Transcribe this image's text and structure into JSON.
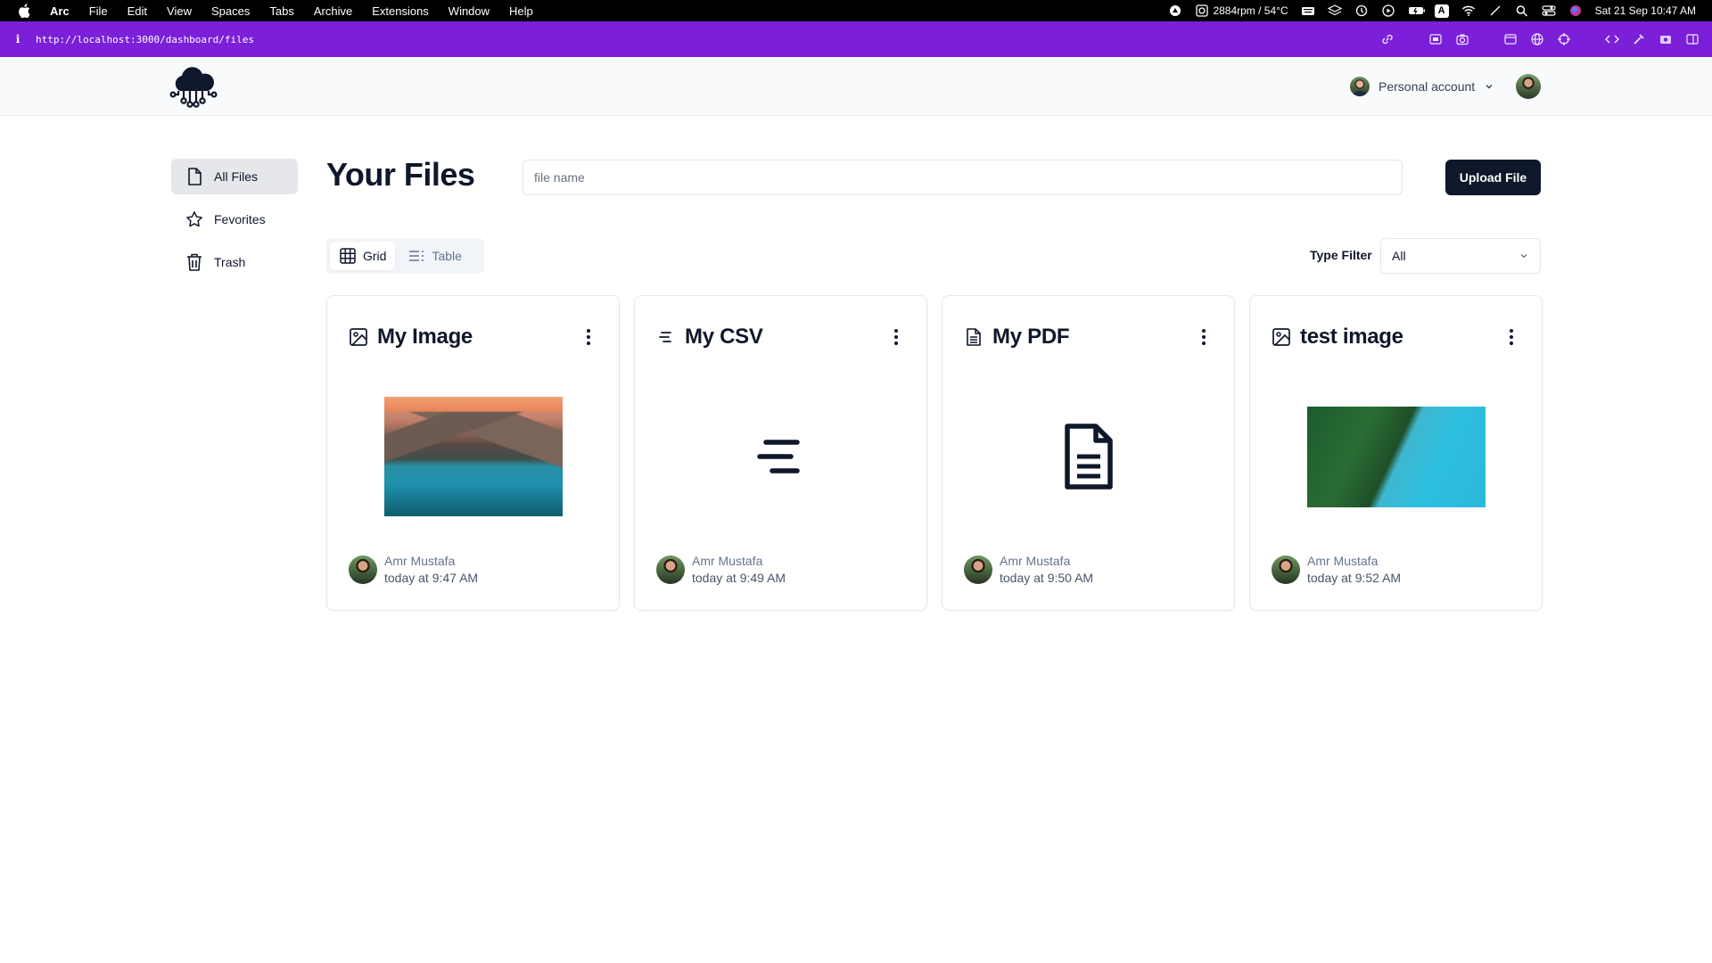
{
  "menubar": {
    "app_name": "Arc",
    "menus": [
      "File",
      "Edit",
      "View",
      "Spaces",
      "Tabs",
      "Archive",
      "Extensions",
      "Window",
      "Help"
    ],
    "fan_stats": "2884rpm / 54°C",
    "input_source": "A",
    "clock": "Sat 21 Sep  10:47 AM"
  },
  "browser": {
    "url": "http://localhost:3000/dashboard/files",
    "info_icon": "i",
    "accent_color": "#7b1fd8"
  },
  "header": {
    "org_label": "Personal account"
  },
  "sidebar": {
    "items": [
      {
        "label": "All Files",
        "icon": "file-icon",
        "active": true
      },
      {
        "label": "Fevorites",
        "icon": "star-icon",
        "active": false
      },
      {
        "label": "Trash",
        "icon": "trash-icon",
        "active": false
      }
    ]
  },
  "main": {
    "title": "Your Files",
    "search_placeholder": "file name",
    "upload_label": "Upload File",
    "view_toggle": {
      "grid": "Grid",
      "table": "Table",
      "selected": "Grid"
    },
    "type_filter": {
      "label": "Type Filter",
      "value": "All"
    }
  },
  "files": [
    {
      "name": "My Image",
      "type": "image",
      "preview": "mountain-lake-photo",
      "author": "Amr Mustafa",
      "date": "today at 9:47 AM"
    },
    {
      "name": "My CSV",
      "type": "csv",
      "preview": "csv-lines-icon",
      "author": "Amr Mustafa",
      "date": "today at 9:49 AM"
    },
    {
      "name": "My PDF",
      "type": "pdf",
      "preview": "document-icon",
      "author": "Amr Mustafa",
      "date": "today at 9:50 AM"
    },
    {
      "name": "test image",
      "type": "image",
      "preview": "forest-lake-aerial-photo",
      "author": "Amr Mustafa",
      "date": "today at 9:52 AM"
    }
  ]
}
